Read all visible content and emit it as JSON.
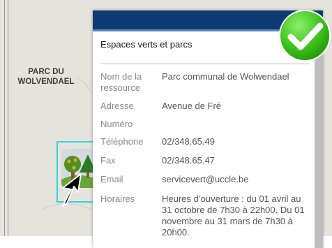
{
  "map": {
    "park_label": "PARC DU WOLVENDAEL",
    "colors": {
      "background": "#e4e4dc",
      "selection": "#33d4de"
    },
    "icons": {
      "marker": "tree-park-icon",
      "cursor": "mouse-pointer-icon"
    }
  },
  "popup": {
    "title": "Espaces verts et parcs",
    "colors": {
      "header": "#0f3b74",
      "scrollbar": "#bdbdbd"
    },
    "attributes": [
      {
        "key": "Nom de la ressource",
        "value": "Parc communal de Wolwendael"
      },
      {
        "key": "Adresse",
        "value": "Avenue de Fré"
      },
      {
        "key": "Numéro",
        "value": ""
      },
      {
        "key": "Téléphone",
        "value": "02/348.65.49"
      },
      {
        "key": "Fax",
        "value": "02/348.65.47"
      },
      {
        "key": "Email",
        "value": "servicevert@uccle.be"
      },
      {
        "key": "Horaires",
        "value": "Heures d’ouverture : du 01 avril au 31 octobre de 7h30 à 22h00. Du 01 novembre au 31 mars de 7h30 à 20h00."
      }
    ]
  },
  "overlay": {
    "icon": "green-checkmark-icon",
    "color": "#3cc21a"
  }
}
